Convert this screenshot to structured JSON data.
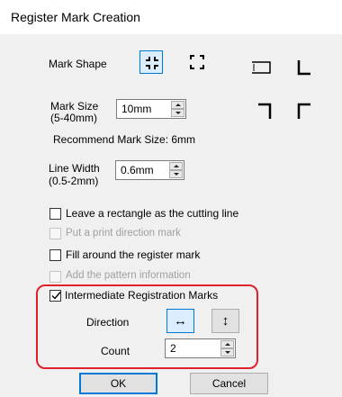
{
  "window": {
    "title": "Register Mark Creation"
  },
  "mark_shape": {
    "label": "Mark Shape"
  },
  "mark_size": {
    "label_line1": "Mark Size",
    "label_line2": "(5-40mm)",
    "value": "10mm",
    "recommend": "Recommend Mark Size:  6mm"
  },
  "line_width": {
    "label_line1": "Line Width",
    "label_line2": "(0.5-2mm)",
    "value": "0.6mm"
  },
  "options": [
    {
      "label": "Leave a rectangle as the cutting line",
      "checked": false,
      "enabled": true
    },
    {
      "label": "Put a print direction mark",
      "checked": false,
      "enabled": false
    },
    {
      "label": "Fill around the register mark",
      "checked": false,
      "enabled": true
    },
    {
      "label": "Add the pattern information",
      "checked": false,
      "enabled": false
    }
  ],
  "intermediate": {
    "label": "Intermediate Registration Marks",
    "checked": true,
    "direction_label": "Direction",
    "direction_horizontal_glyph": "↔",
    "direction_vertical_glyph": "↕",
    "count_label": "Count",
    "count_value": "2"
  },
  "buttons": {
    "ok": "OK",
    "cancel": "Cancel"
  },
  "colors": {
    "highlight": "#e0212b",
    "accent": "#0078d7"
  }
}
